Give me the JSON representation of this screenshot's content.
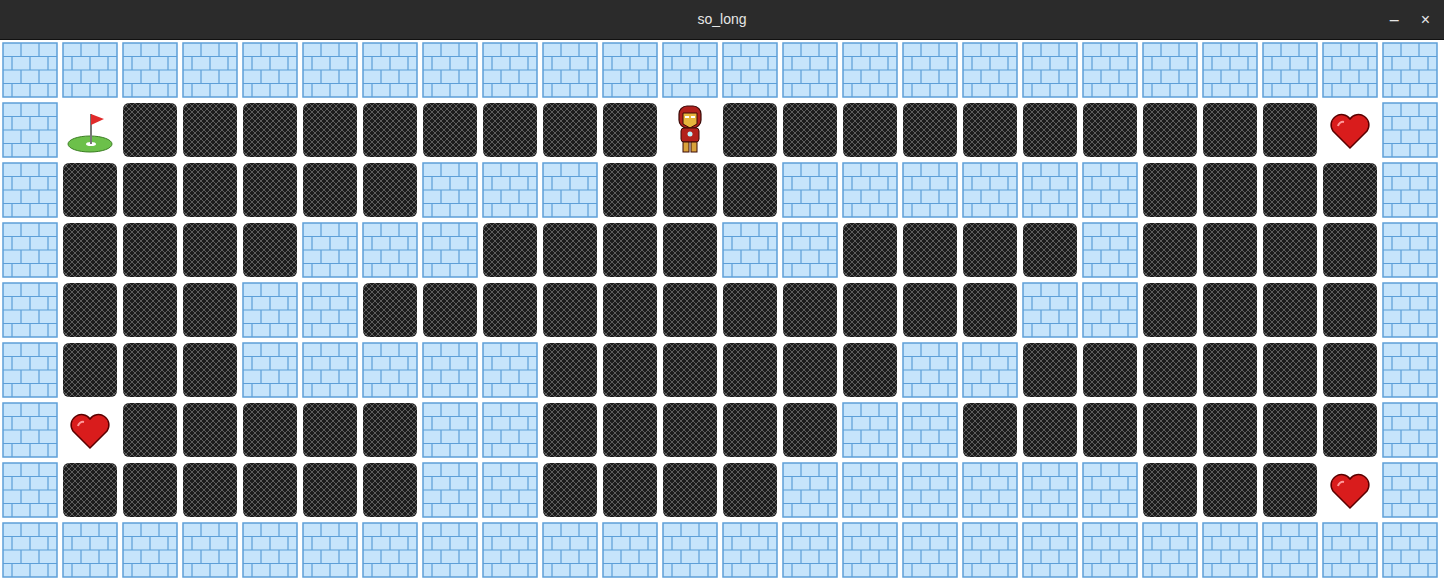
{
  "window": {
    "title": "so_long",
    "controls": [
      "–",
      "×"
    ]
  },
  "map": {
    "rows": [
      [
        "wall",
        "wall",
        "wall",
        "wall",
        "wall",
        "wall",
        "wall",
        "wall",
        "wall",
        "wall",
        "wall",
        "wall",
        "wall",
        "wall",
        "wall",
        "wall",
        "wall",
        "wall",
        "wall",
        "wall",
        "wall",
        "wall",
        "wall",
        "wall"
      ],
      [
        "wall",
        "exit",
        "floor",
        "floor",
        "floor",
        "floor",
        "floor",
        "floor",
        "floor",
        "floor",
        "floor",
        "player",
        "floor",
        "floor",
        "floor",
        "floor",
        "floor",
        "floor",
        "floor",
        "floor",
        "floor",
        "floor",
        "collectible",
        "wall"
      ],
      [
        "wall",
        "floor",
        "floor",
        "floor",
        "floor",
        "floor",
        "floor",
        "wall",
        "wall",
        "wall",
        "floor",
        "floor",
        "floor",
        "wall",
        "wall",
        "wall",
        "wall",
        "wall",
        "wall",
        "floor",
        "floor",
        "floor",
        "floor",
        "wall"
      ],
      [
        "wall",
        "floor",
        "floor",
        "floor",
        "floor",
        "wall",
        "wall",
        "wall",
        "floor",
        "floor",
        "floor",
        "floor",
        "wall",
        "wall",
        "floor",
        "floor",
        "floor",
        "floor",
        "wall",
        "floor",
        "floor",
        "floor",
        "floor",
        "wall"
      ],
      [
        "wall",
        "floor",
        "floor",
        "floor",
        "wall",
        "wall",
        "floor",
        "floor",
        "floor",
        "floor",
        "floor",
        "floor",
        "floor",
        "floor",
        "floor",
        "floor",
        "floor",
        "wall",
        "wall",
        "floor",
        "floor",
        "floor",
        "floor",
        "wall"
      ],
      [
        "wall",
        "floor",
        "floor",
        "floor",
        "wall",
        "wall",
        "wall",
        "wall",
        "wall",
        "floor",
        "floor",
        "floor",
        "floor",
        "floor",
        "floor",
        "wall",
        "wall",
        "floor",
        "floor",
        "floor",
        "floor",
        "floor",
        "floor",
        "wall"
      ],
      [
        "wall",
        "collectible",
        "floor",
        "floor",
        "floor",
        "floor",
        "floor",
        "wall",
        "wall",
        "floor",
        "floor",
        "floor",
        "floor",
        "floor",
        "wall",
        "wall",
        "floor",
        "floor",
        "floor",
        "floor",
        "floor",
        "floor",
        "floor",
        "wall"
      ],
      [
        "wall",
        "floor",
        "floor",
        "floor",
        "floor",
        "floor",
        "floor",
        "wall",
        "wall",
        "floor",
        "floor",
        "floor",
        "floor",
        "wall",
        "wall",
        "wall",
        "wall",
        "wall",
        "wall",
        "floor",
        "floor",
        "floor",
        "collectible",
        "wall"
      ],
      [
        "wall",
        "wall",
        "wall",
        "wall",
        "wall",
        "wall",
        "wall",
        "wall",
        "wall",
        "wall",
        "wall",
        "wall",
        "wall",
        "wall",
        "wall",
        "wall",
        "wall",
        "wall",
        "wall",
        "wall",
        "wall",
        "wall",
        "wall",
        "wall"
      ]
    ]
  }
}
